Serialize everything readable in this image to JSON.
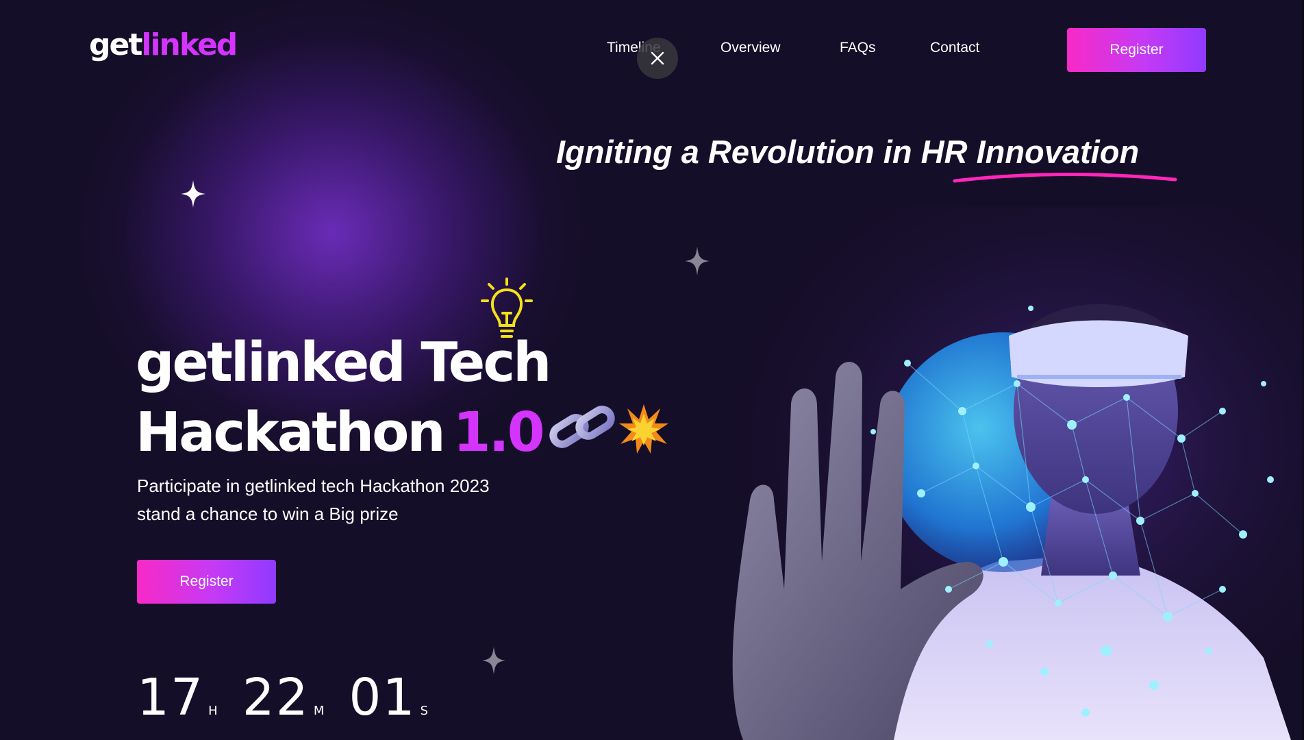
{
  "logo": {
    "part1": "get",
    "part2": "linked"
  },
  "nav": {
    "timeline": "Timeline",
    "overview": "Overview",
    "faqs": "FAQs",
    "contact": "Contact"
  },
  "header": {
    "register_label": "Register"
  },
  "hero": {
    "tagline": "Igniting a Revolution in HR Innovation",
    "headline_line1": "getlinked Tech",
    "headline_line2": "Hackathon",
    "version": "1.0",
    "subtext_line1": "Participate in getlinked tech Hackathon 2023",
    "subtext_line2": "stand a chance to win a Big prize",
    "register_label": "Register"
  },
  "countdown": {
    "hours": "17",
    "hours_unit": "H",
    "minutes": "22",
    "minutes_unit": "M",
    "seconds": "01",
    "seconds_unit": "S"
  },
  "colors": {
    "background": "#150e28",
    "accent_purple": "#d434fe",
    "accent_pink": "#ff26b9",
    "button_gradient_start": "#f82ac7",
    "button_gradient_end": "#903aff"
  },
  "icons": {
    "close": "close-icon",
    "bulb": "lightbulb-icon",
    "chain": "chain-icon",
    "burst": "explosion-icon",
    "sparkle": "sparkle-star-icon"
  }
}
